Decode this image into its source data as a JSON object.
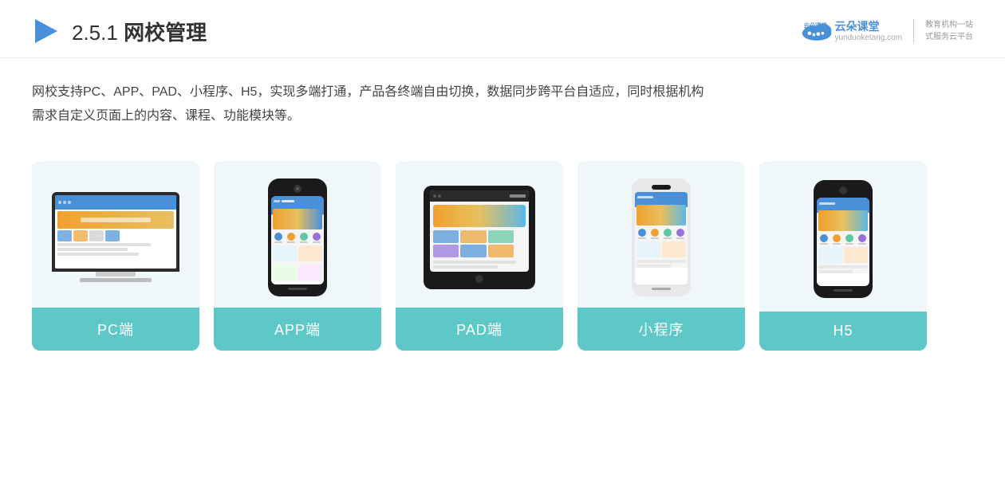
{
  "header": {
    "title_prefix": "2.5.1 ",
    "title_bold": "网校管理",
    "brand": {
      "name": "云朵课堂",
      "url_text": "yunduoketang.com",
      "slogan_line1": "教育机构一站",
      "slogan_line2": "式服务云平台"
    }
  },
  "description": {
    "line1": "网校支持PC、APP、PAD、小程序、H5，实现多端打通，产品各终端自由切换，数据同步跨平台自适应，同时根据机构",
    "line2": "需求自定义页面上的内容、课程、功能模块等。"
  },
  "cards": [
    {
      "id": "pc",
      "label": "PC端"
    },
    {
      "id": "app",
      "label": "APP端"
    },
    {
      "id": "pad",
      "label": "PAD端"
    },
    {
      "id": "mini",
      "label": "小程序"
    },
    {
      "id": "h5",
      "label": "H5"
    }
  ],
  "colors": {
    "card_label_bg": "#5ec8c8",
    "card_bg": "#eaf5f8",
    "accent_blue": "#4a90d9",
    "accent_orange": "#f0a030"
  }
}
